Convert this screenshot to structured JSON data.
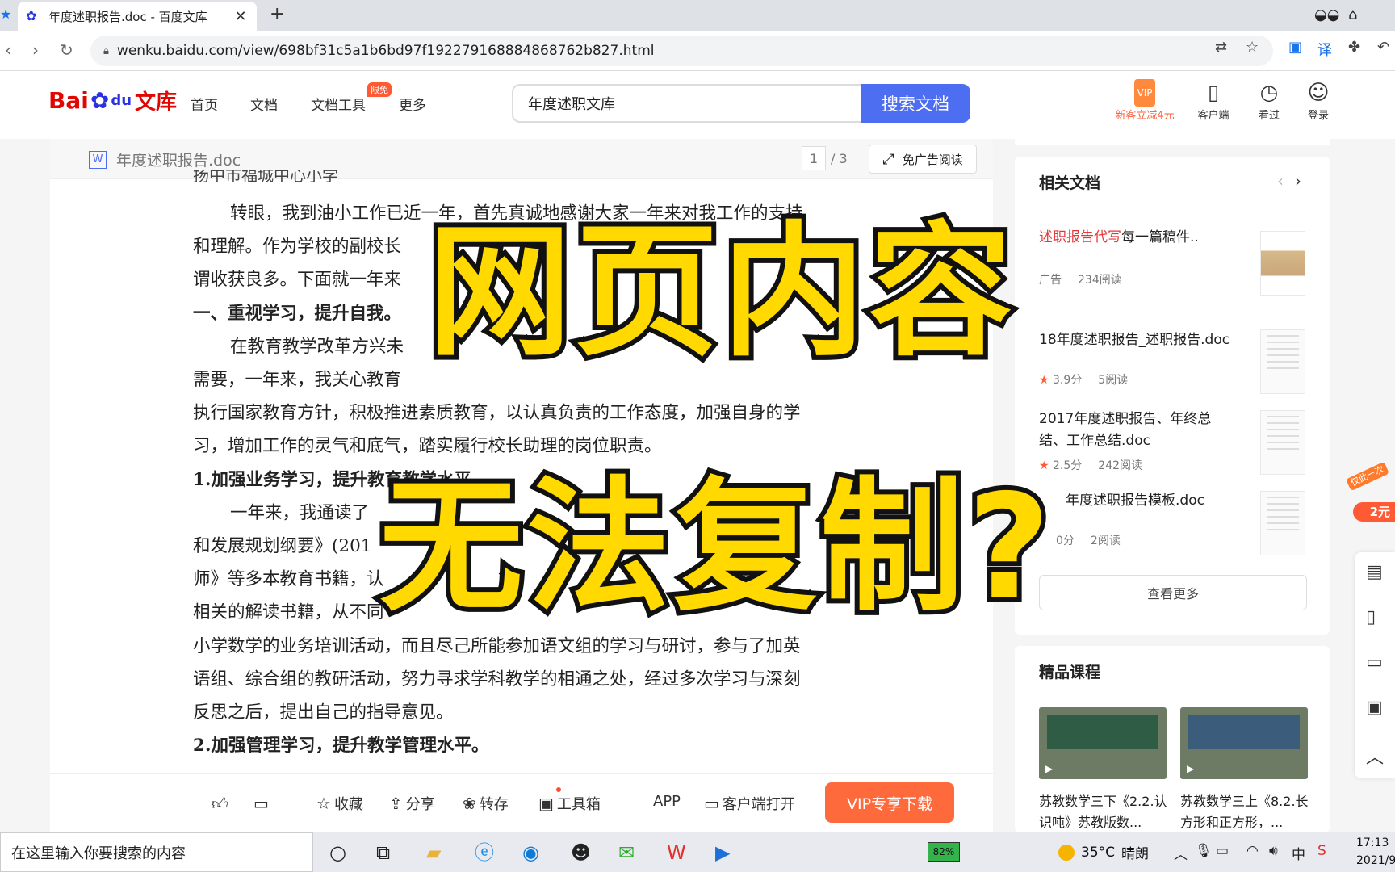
{
  "browser": {
    "tab_title": "年度述职报告.doc - 百度文库",
    "url": "wenku.baidu.com/view/698bf31c5a1b6bd97f192279168884868762b827.html"
  },
  "site": {
    "logo_bai": "Bai",
    "logo_du": "du",
    "logo_wenku": "文库",
    "nav": [
      "首页",
      "文档",
      "文档工具",
      "更多"
    ],
    "tool_badge": "限免",
    "search_value": "年度述职文库",
    "search_button": "搜索文档",
    "header_actions": {
      "vip_promo": "新客立减4元",
      "vip_tag": "VIP",
      "client": "客户端",
      "history": "看过",
      "login": "登录"
    }
  },
  "doc": {
    "name": "年度述职报告.doc",
    "page_current": "1",
    "page_total": "/ 3",
    "no_ad_label": "免广告阅读",
    "cut_line": "扬中市福城中心小学",
    "paragraphs": [
      {
        "text": "转眼，我到油小工作已近一年，首先真诚地感谢大家一年来对我工作的支持",
        "style": "i"
      },
      {
        "text": "和理解。作为学校的副校长",
        "style": ""
      },
      {
        "text": "谓收获良多。下面就一年来",
        "style": ""
      },
      {
        "text": "一、重视学习，提升自我。",
        "style": "b"
      },
      {
        "text": "在教育教学改革方兴未",
        "style": "i"
      },
      {
        "text": "需要，一年来，我关心教育",
        "style": ""
      },
      {
        "text": "执行国家教育方针，积极推进素质教育，以认真负责的工作态度，加强自身的学",
        "style": ""
      },
      {
        "text": "习，增加工作的灵气和底气，踏实履行校长助理的岗位职责。",
        "style": ""
      },
      {
        "text": "1.加强业务学习，提升教育教学水平。",
        "style": "b"
      },
      {
        "text": "一年来，我通读了",
        "style": "i"
      },
      {
        "text": "和发展规划纲要》(201",
        "style": ""
      },
      {
        "text": "师》等多本教育书籍，认",
        "style": ""
      },
      {
        "text": "相关的解读书籍，从不同",
        "style": ""
      },
      {
        "text": "小学数学的业务培训活动，而且尽己所能参加语文组的学习与研讨，参与了加英",
        "style": ""
      },
      {
        "text": "语组、综合组的教研活动，努力寻求学科教学的相通之处，经过多次学习与深刻",
        "style": ""
      },
      {
        "text": "反思之后，提出自己的指导意见。",
        "style": ""
      },
      {
        "text": "2.加强管理学习，提升教学管理水平。",
        "style": "b"
      }
    ]
  },
  "toolbar": {
    "like": "",
    "comment": "",
    "collect": "收藏",
    "share": "分享",
    "transfer": "转存",
    "toolbox": "工具箱",
    "app": "APP",
    "open_client": "客户端打开",
    "vip_download": "VIP专享下载"
  },
  "sidebar": {
    "related_title": "相关文档",
    "related": [
      {
        "ad_prefix": "述职报告代写",
        "title": "每一篇稿件..",
        "meta1": "广告",
        "meta2": "234阅读",
        "star": false
      },
      {
        "ad_prefix": "",
        "title": "18年度述职报告_述职报告.doc",
        "meta1": "3.9分",
        "meta2": "5阅读",
        "star": true
      },
      {
        "ad_prefix": "",
        "title": "2017年度述职报告、年终总结、工作总结.doc",
        "meta1": "2.5分",
        "meta2": "242阅读",
        "star": true
      },
      {
        "ad_prefix": "",
        "title": "年度述职报告模板.doc",
        "meta1": "0分",
        "meta2": "2阅读",
        "star": true
      }
    ],
    "see_more": "查看更多",
    "courses_title": "精品课程",
    "courses": [
      {
        "title": "苏教数学三下《2.2.认识吨》苏教版数..."
      },
      {
        "title": "苏教数学三上《8.2.长方形和正方形，..."
      }
    ],
    "promo_small": "仅此一次",
    "promo_price": "2元"
  },
  "overlay": {
    "line1": "网页内容",
    "line2": "无法复制?"
  },
  "taskbar": {
    "search_placeholder": "在这里输入你要搜索的内容",
    "battery": "82%",
    "temperature": "35°C",
    "weather": "晴朗",
    "time": "17:13",
    "date": "2021/9,"
  }
}
